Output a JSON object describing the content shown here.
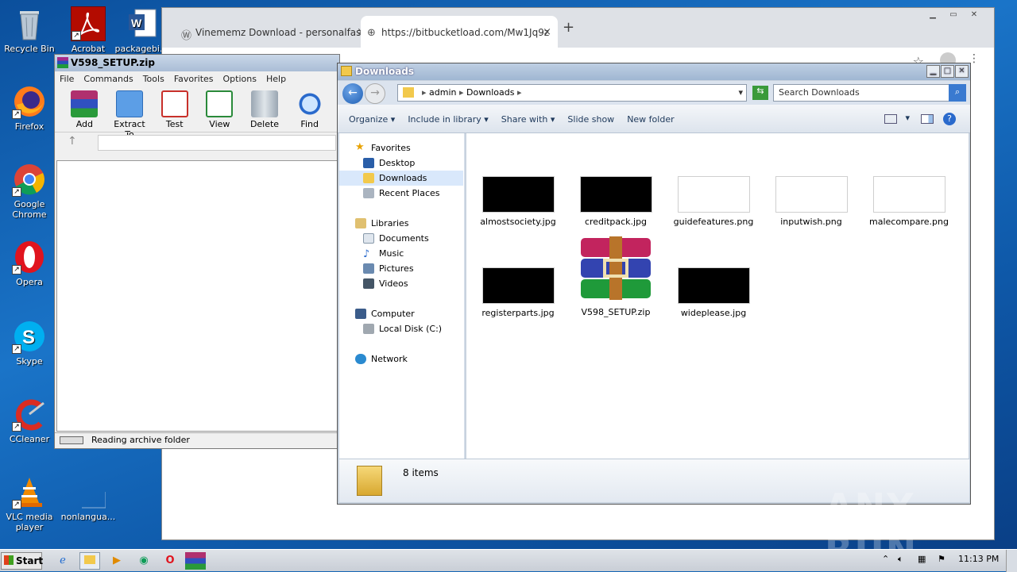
{
  "desktop": {
    "icons": [
      {
        "label": "Recycle Bin",
        "icon": "recycle-bin-icon"
      },
      {
        "label": "Acrobat",
        "icon": "acrobat-icon"
      },
      {
        "label": "packagebi...",
        "icon": "word-doc-icon"
      },
      {
        "label": "Firefox",
        "icon": "firefox-icon"
      },
      {
        "label": "Google Chrome",
        "icon": "chrome-icon"
      },
      {
        "label": "Opera",
        "icon": "opera-icon"
      },
      {
        "label": "Skype",
        "icon": "skype-icon"
      },
      {
        "label": "CCleaner",
        "icon": "ccleaner-icon"
      },
      {
        "label": "VLC media player",
        "icon": "vlc-icon"
      },
      {
        "label": "nonlangua...",
        "icon": "blank-file-icon"
      }
    ]
  },
  "chrome": {
    "tabs": [
      {
        "title": "Vinememz Download - personalfasr",
        "close": "×"
      },
      {
        "title": "https://bitbucketload.com/Mw1Jq9z",
        "close": "×"
      }
    ],
    "new_tab": "+"
  },
  "winrar": {
    "title": "V598_SETUP.zip",
    "menu": [
      "File",
      "Commands",
      "Tools",
      "Favorites",
      "Options",
      "Help"
    ],
    "toolbar": [
      "Add",
      "Extract To",
      "Test",
      "View",
      "Delete",
      "Find"
    ],
    "status": "Reading archive folder",
    "up_arrow": "↑"
  },
  "explorer": {
    "title": "Downloads",
    "breadcrumb": [
      "admin",
      "Downloads"
    ],
    "search_placeholder": "Search Downloads",
    "commands": [
      "Organize",
      "Include in library",
      "Share with",
      "Slide show",
      "New folder"
    ],
    "nav": {
      "favorites": "Favorites",
      "desktop": "Desktop",
      "downloads": "Downloads",
      "recent": "Recent Places",
      "libraries": "Libraries",
      "documents": "Documents",
      "music": "Music",
      "pictures": "Pictures",
      "videos": "Videos",
      "computer": "Computer",
      "localdisk": "Local Disk (C:)",
      "network": "Network"
    },
    "files": [
      {
        "name": "almostsociety.jpg",
        "thumb": "#000000"
      },
      {
        "name": "creditpack.jpg",
        "thumb": "#000000"
      },
      {
        "name": "guidefeatures.png",
        "thumb": "#ffffff"
      },
      {
        "name": "inputwish.png",
        "thumb": "#ffffff"
      },
      {
        "name": "malecompare.png",
        "thumb": "#ffffff"
      },
      {
        "name": "registerparts.jpg",
        "thumb": "#000000"
      },
      {
        "name": "V598_SETUP.zip",
        "thumb": "winrar-archive-icon"
      },
      {
        "name": "wideplease.jpg",
        "thumb": "#000000"
      }
    ],
    "item_count": "8 items"
  },
  "taskbar": {
    "start": "Start",
    "clock": "11:13 PM"
  },
  "watermark": "ANY RUN"
}
